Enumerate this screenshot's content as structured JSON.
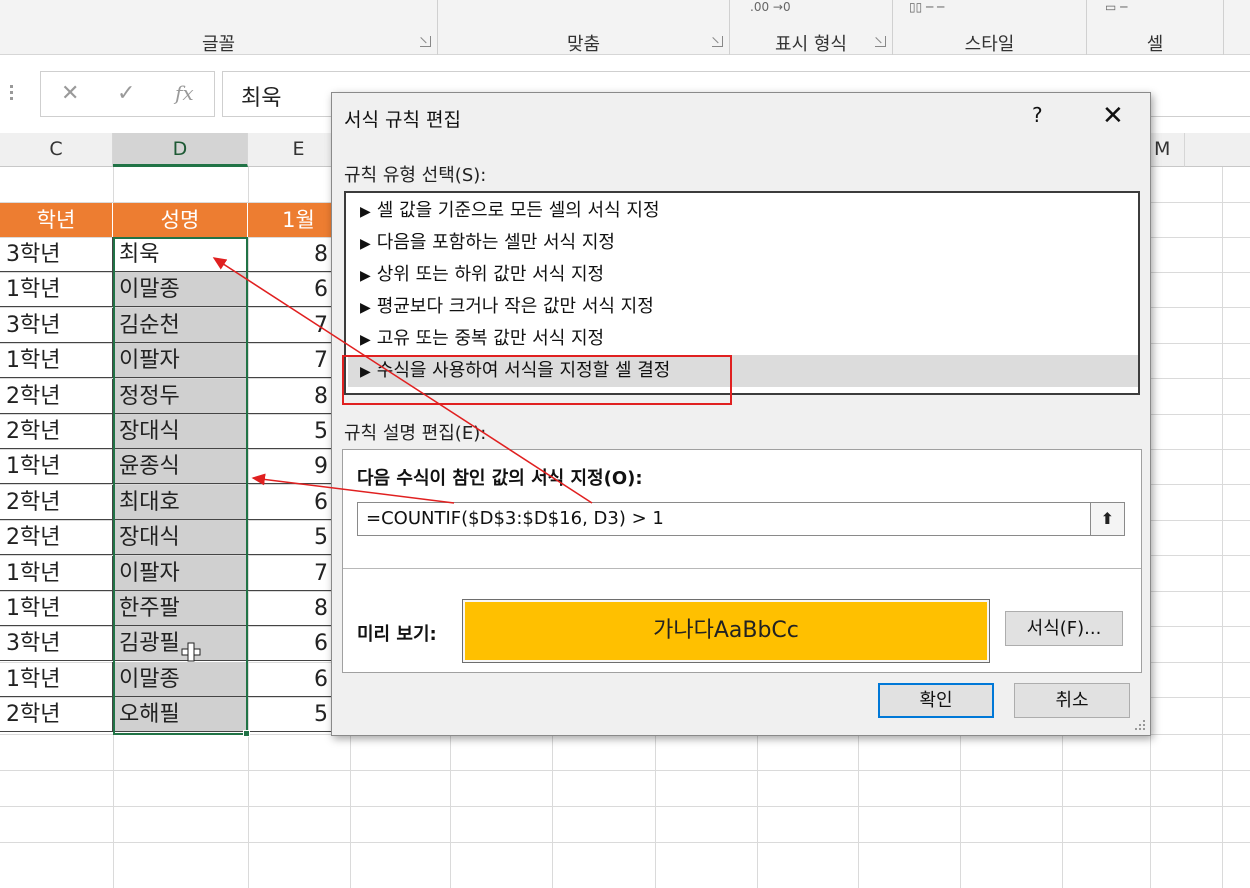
{
  "ribbon": {
    "groups": [
      {
        "label": "글꼴"
      },
      {
        "label": "맞춤"
      },
      {
        "label": "표시 형식"
      },
      {
        "label": "스타일"
      },
      {
        "label": "셀"
      }
    ]
  },
  "formula_bar": {
    "cancel_icon": "cancel-x-icon",
    "enter_icon": "checkmark-icon",
    "function_icon": "fx-icon",
    "function_label": "fx",
    "value": "최욱"
  },
  "columns": [
    "C",
    "D",
    "E",
    "M"
  ],
  "table": {
    "headers": [
      "학년",
      "성명",
      "1월"
    ],
    "rows": [
      {
        "grade": "3학년",
        "name": "최욱",
        "value": "8"
      },
      {
        "grade": "1학년",
        "name": "이말종",
        "value": "6"
      },
      {
        "grade": "3학년",
        "name": "김순천",
        "value": "7"
      },
      {
        "grade": "1학년",
        "name": "이팔자",
        "value": "7"
      },
      {
        "grade": "2학년",
        "name": "정정두",
        "value": "8"
      },
      {
        "grade": "2학년",
        "name": "장대식",
        "value": "5"
      },
      {
        "grade": "1학년",
        "name": "윤종식",
        "value": "9"
      },
      {
        "grade": "2학년",
        "name": "최대호",
        "value": "6"
      },
      {
        "grade": "2학년",
        "name": "장대식",
        "value": "5"
      },
      {
        "grade": "1학년",
        "name": "이팔자",
        "value": "7"
      },
      {
        "grade": "1학년",
        "name": "한주팔",
        "value": "8"
      },
      {
        "grade": "3학년",
        "name": "김광필",
        "value": "6"
      },
      {
        "grade": "1학년",
        "name": "이말종",
        "value": "6"
      },
      {
        "grade": "2학년",
        "name": "오해필",
        "value": "5"
      }
    ]
  },
  "dialog": {
    "title": "서식 규칙 편집",
    "help": "?",
    "close_icon": "close-icon",
    "rule_type_label": "규칙 유형 선택(S):",
    "rule_types": [
      "셀 값을 기준으로 모든 셀의 서식 지정",
      "다음을 포함하는 셀만 서식 지정",
      "상위 또는 하위 값만 서식 지정",
      "평균보다 크거나 작은 값만 서식 지정",
      "고유 또는 중복 값만 서식 지정",
      "수식을 사용하여 서식을 지정할 셀 결정"
    ],
    "selected_rule_index": 5,
    "rule_desc_label": "규칙 설명 편집(E):",
    "formula_title": "다음 수식이 참인 값의 서식 지정(O):",
    "formula": "=COUNTIF($D$3:$D$16, D3) > 1",
    "preview_label": "미리 보기:",
    "preview_text": "가나다AaBbCc",
    "preview_color": "#ffc000",
    "format_button": "서식(F)...",
    "ok_button": "확인",
    "cancel_button": "취소"
  },
  "colors": {
    "header_orange": "#ed7d31",
    "selection_green": "#217346",
    "duplicate_grey": "#d0d0d0",
    "annotation_red": "#e02020"
  }
}
